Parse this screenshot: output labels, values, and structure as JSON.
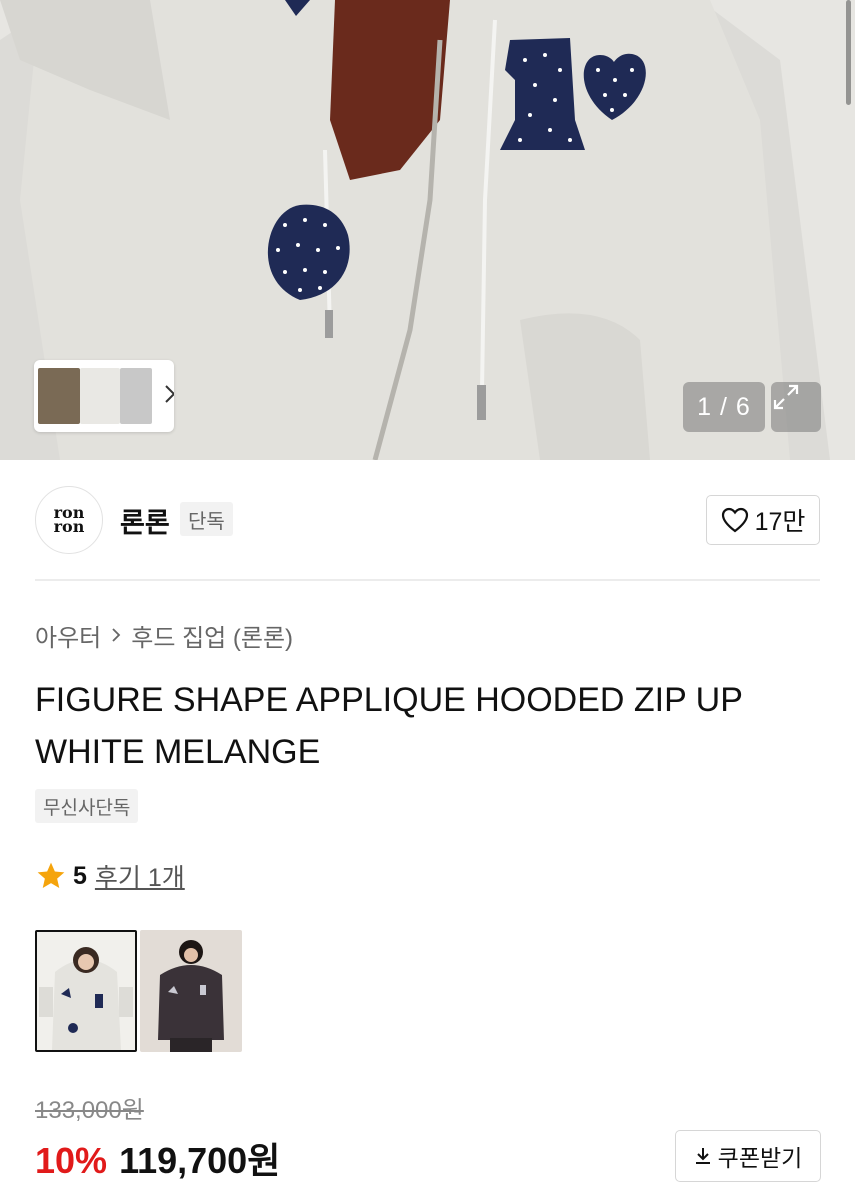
{
  "gallery": {
    "counter": "1 / 6",
    "thumbs_next_icon": "chevron-right-icon",
    "expand_icon": "expand-icon"
  },
  "brand": {
    "logo_line1": "ron",
    "logo_line2": "ron",
    "name": "론론",
    "badge": "단독",
    "likes": "17만"
  },
  "product": {
    "breadcrumb": [
      "아우터",
      "후드 집업 (론론)"
    ],
    "title": "FIGURE SHAPE APPLIQUE HOODED ZIP UP WHITE MELANGE",
    "tag": "무신사단독",
    "rating": {
      "score": "5",
      "reviews": "후기 1개"
    },
    "color_options": [
      "white-melange",
      "charcoal"
    ],
    "original_price": "133,000원",
    "discount": "10%",
    "price": "119,700원",
    "coupon_label": "쿠폰받기"
  },
  "colors": {
    "discount": "#e11a1a",
    "rating_star": "#f5a40c",
    "appliqué_navy": "#1f2a55"
  }
}
